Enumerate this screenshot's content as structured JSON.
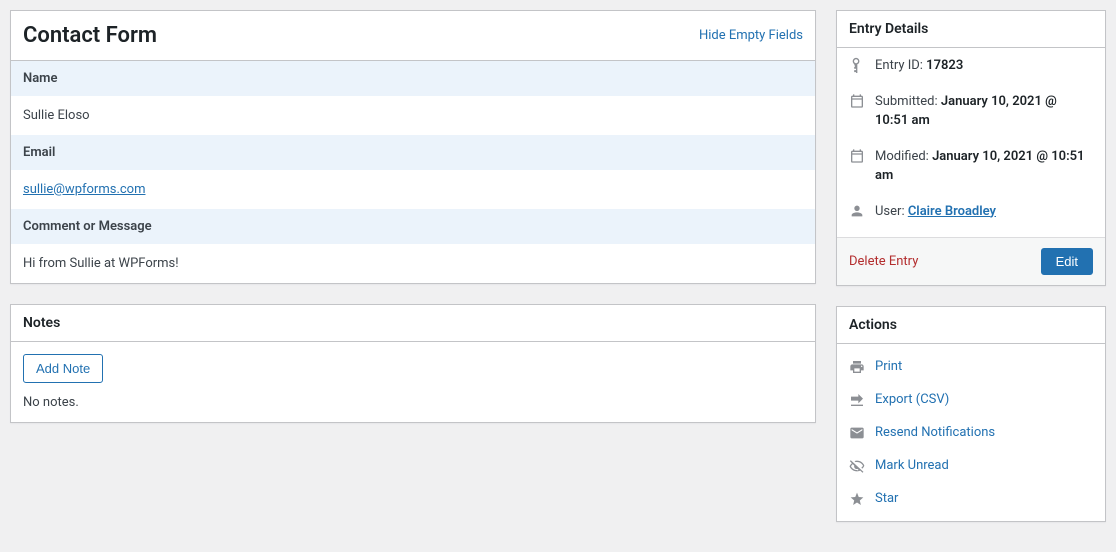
{
  "contact": {
    "title": "Contact Form",
    "hide_link": "Hide Empty Fields",
    "fields": {
      "name_label": "Name",
      "name_value": "Sullie Eloso",
      "email_label": "Email",
      "email_value": "sullie@wpforms.com",
      "message_label": "Comment or Message",
      "message_value": "Hi from Sullie at WPForms!"
    }
  },
  "notes": {
    "title": "Notes",
    "add_btn": "Add Note",
    "empty_text": "No notes."
  },
  "details": {
    "title": "Entry Details",
    "entry_id_label": "Entry ID: ",
    "entry_id_value": "17823",
    "submitted_label": "Submitted: ",
    "submitted_value": "January 10, 2021 @ 10:51 am",
    "modified_label": "Modified: ",
    "modified_value": "January 10, 2021 @ 10:51 am",
    "user_label": "User: ",
    "user_value": "Claire Broadley",
    "delete_label": "Delete Entry",
    "edit_label": "Edit"
  },
  "actions": {
    "title": "Actions",
    "print": "Print",
    "export": "Export (CSV)",
    "resend": "Resend Notifications",
    "mark_unread": "Mark Unread",
    "star": "Star"
  }
}
